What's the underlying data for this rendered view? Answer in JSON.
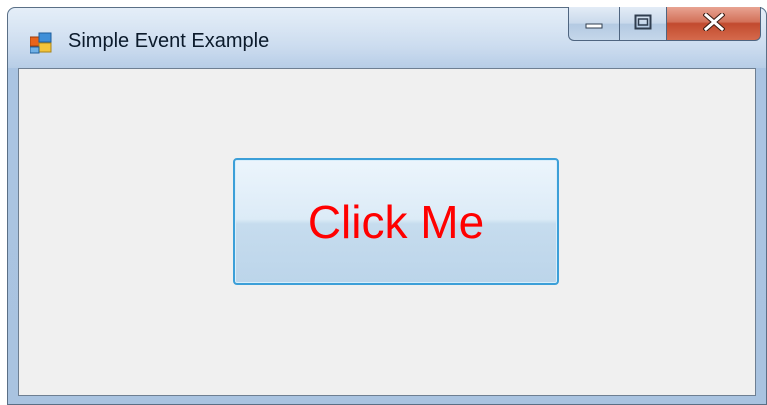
{
  "window": {
    "title": "Simple Event Example",
    "icon": "winforms-app-icon"
  },
  "caption_buttons": {
    "minimize_icon": "minimize-icon",
    "maximize_icon": "maximize-icon",
    "close_icon": "close-icon",
    "close_glyph": "X"
  },
  "main": {
    "button_label": "Click Me",
    "button_text_color": "#ff0000",
    "button_border_color": "#3c9fd8"
  },
  "colors": {
    "client_background": "#f0f0f0",
    "close_button": "#c24a2e"
  }
}
